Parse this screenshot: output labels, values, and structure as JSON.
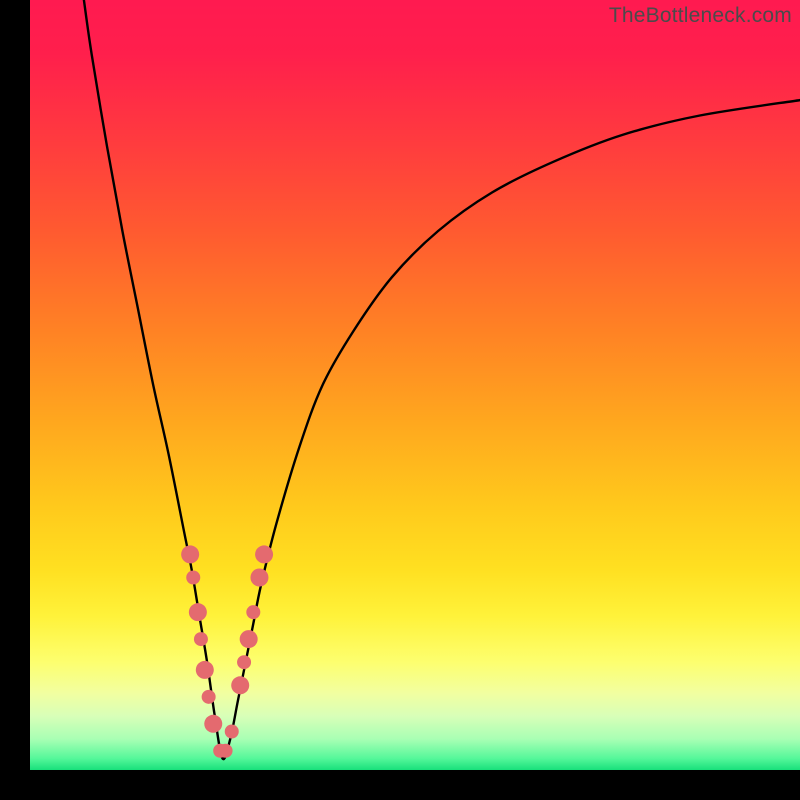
{
  "watermark": "TheBottleneck.com",
  "gradient": {
    "stops": [
      {
        "offset": 0.0,
        "color": "#ff1a50"
      },
      {
        "offset": 0.07,
        "color": "#ff1f4c"
      },
      {
        "offset": 0.18,
        "color": "#ff3a3f"
      },
      {
        "offset": 0.3,
        "color": "#ff5a30"
      },
      {
        "offset": 0.42,
        "color": "#ff7f25"
      },
      {
        "offset": 0.55,
        "color": "#ffa81e"
      },
      {
        "offset": 0.66,
        "color": "#ffca1c"
      },
      {
        "offset": 0.74,
        "color": "#ffe021"
      },
      {
        "offset": 0.8,
        "color": "#fff23a"
      },
      {
        "offset": 0.86,
        "color": "#fdff6f"
      },
      {
        "offset": 0.9,
        "color": "#f2ffa0"
      },
      {
        "offset": 0.93,
        "color": "#d8ffb8"
      },
      {
        "offset": 0.96,
        "color": "#a8ffb4"
      },
      {
        "offset": 0.985,
        "color": "#55f79a"
      },
      {
        "offset": 1.0,
        "color": "#18e07b"
      }
    ]
  },
  "chart_data": {
    "type": "line",
    "title": "",
    "xlabel": "",
    "ylabel": "",
    "xlim": [
      0,
      100
    ],
    "ylim": [
      0,
      100
    ],
    "x_min_at": 25,
    "series": [
      {
        "name": "bottleneck-curve",
        "x": [
          7,
          8,
          10,
          12,
          14,
          16,
          18,
          20,
          21,
          22,
          23,
          24,
          25,
          26,
          27,
          28,
          29,
          30,
          32,
          35,
          38,
          42,
          47,
          53,
          60,
          68,
          77,
          87,
          100
        ],
        "y": [
          100,
          93,
          81,
          70,
          60,
          50,
          41,
          31,
          26,
          20,
          14,
          7,
          1.5,
          4,
          9,
          14,
          19,
          24,
          32,
          42,
          50,
          57,
          64,
          70,
          75,
          79,
          82.5,
          85,
          87
        ]
      }
    ],
    "markers": {
      "name": "sample-points",
      "color": "#e46a6f",
      "radius_major": 9,
      "radius_minor": 7,
      "points": [
        {
          "x": 20.8,
          "y": 28,
          "r": "major"
        },
        {
          "x": 21.2,
          "y": 25,
          "r": "minor"
        },
        {
          "x": 21.8,
          "y": 20.5,
          "r": "major"
        },
        {
          "x": 22.2,
          "y": 17,
          "r": "minor"
        },
        {
          "x": 22.7,
          "y": 13,
          "r": "major"
        },
        {
          "x": 23.2,
          "y": 9.5,
          "r": "minor"
        },
        {
          "x": 23.8,
          "y": 6,
          "r": "major"
        },
        {
          "x": 24.7,
          "y": 2.5,
          "r": "minor"
        },
        {
          "x": 25.4,
          "y": 2.5,
          "r": "minor"
        },
        {
          "x": 26.2,
          "y": 5,
          "r": "minor"
        },
        {
          "x": 27.3,
          "y": 11,
          "r": "major"
        },
        {
          "x": 27.8,
          "y": 14,
          "r": "minor"
        },
        {
          "x": 28.4,
          "y": 17,
          "r": "major"
        },
        {
          "x": 29.0,
          "y": 20.5,
          "r": "minor"
        },
        {
          "x": 29.8,
          "y": 25,
          "r": "major"
        },
        {
          "x": 30.4,
          "y": 28,
          "r": "major"
        }
      ]
    }
  }
}
